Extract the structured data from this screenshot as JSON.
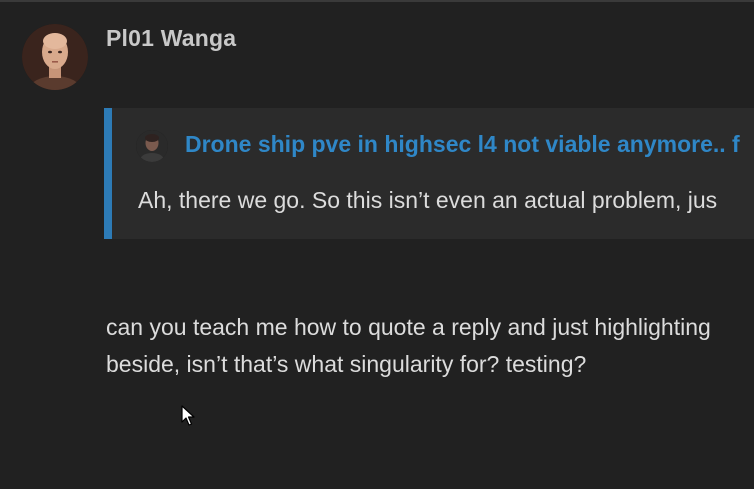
{
  "post": {
    "author": "Pl01 Wanga",
    "quote": {
      "topic_title": "Drone ship pve in highsec l4 not viable anymore.. f",
      "text": "Ah, there we go. So this isn’t even an actual problem, jus"
    },
    "body_lines": [
      "can you teach me how to quote a reply and just highlighting",
      "beside, isn’t that’s what singularity for? testing?"
    ]
  },
  "colors": {
    "background": "#212121",
    "quote_background": "#2b2b2b",
    "quote_border": "#2d7bb6",
    "link": "#2f87c7"
  },
  "icons": {
    "author_avatar": "user-avatar-icon",
    "quote_avatar": "quoted-user-avatar-icon",
    "cursor": "mouse-pointer-icon"
  }
}
